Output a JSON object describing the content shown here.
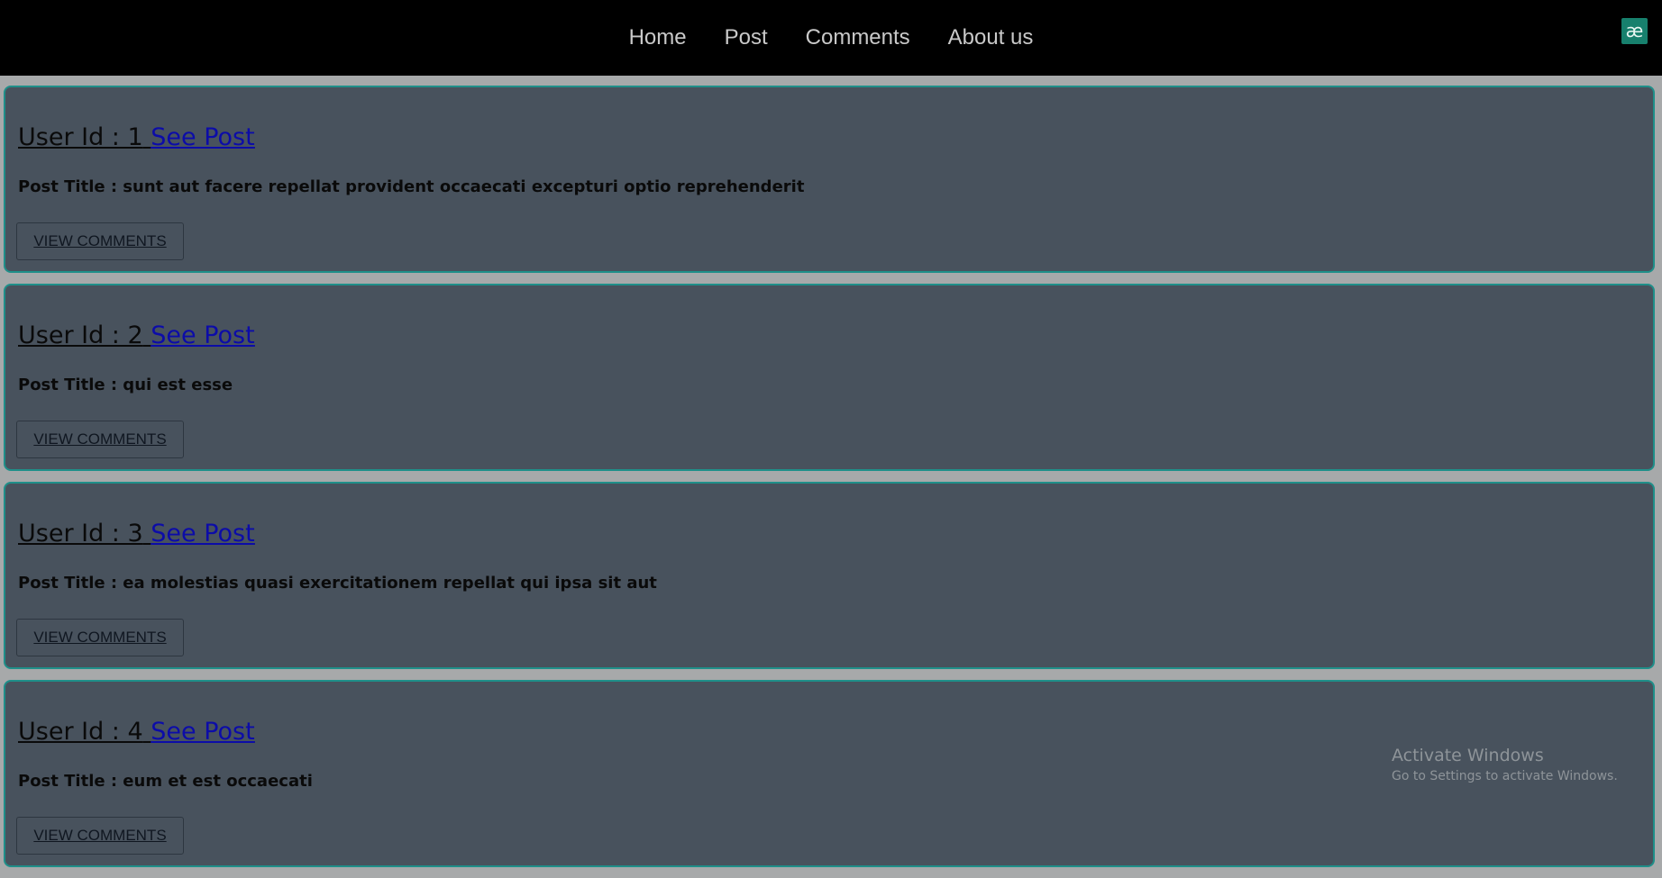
{
  "nav": {
    "items": [
      "Home",
      "Post",
      "Comments",
      "About us"
    ]
  },
  "extension_icon": {
    "glyph": "æ",
    "color": "#17806d"
  },
  "cards": [
    {
      "heading": "User Id : 1",
      "link": "See Post",
      "title": "Post Title : sunt aut facere repellat provident occaecati excepturi optio reprehenderit",
      "button": "VIEW COMMENTS"
    },
    {
      "heading": "User Id : 2",
      "link": "See Post",
      "title": "Post Title : qui est esse",
      "button": "VIEW COMMENTS"
    },
    {
      "heading": "User Id : 3",
      "link": "See Post",
      "title": "Post Title : ea molestias quasi exercitationem repellat qui ipsa sit aut",
      "button": "VIEW COMMENTS"
    },
    {
      "heading": "User Id : 4",
      "link": "See Post",
      "title": "Post Title : eum et est occaecati",
      "button": "VIEW COMMENTS"
    }
  ],
  "watermark": {
    "title": "Activate Windows",
    "subtitle": "Go to Settings to activate Windows."
  },
  "colors": {
    "navbar_bg": "#000000",
    "page_bg": "#a7a9aa",
    "card_bg": "#48525d",
    "card_border": "#1f8f89",
    "link": "#0c0ca8"
  }
}
